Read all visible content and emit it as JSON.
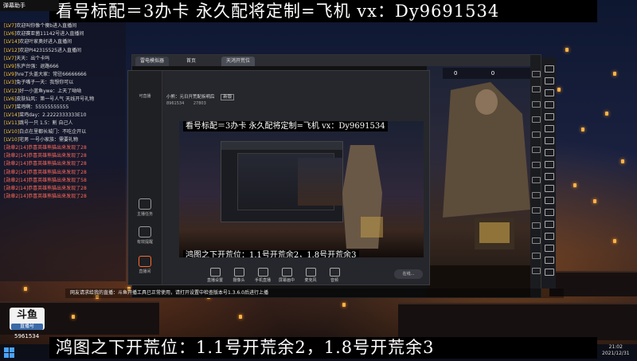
{
  "banner": {
    "top": "看号标配＝3办卡 永久配将定制=飞机 vx：Dy9691534",
    "bottom": "鸿图之下开荒位：1.1号开荒余2，1.8号开荒余3"
  },
  "nested_banner": {
    "top": "看号标配＝3办卡 永久配将定制=飞机 vx：Dy9691534",
    "bottom": "鸿图之下开荒位：1.1号开荒余2，1.8号开荒余3"
  },
  "chat": {
    "top_tag": "弹幕助手",
    "lines": [
      {
        "prefix": "[LV7]",
        "text": "欢迎叫你像个傻b进入直播间"
      },
      {
        "prefix": "[LV6]",
        "text": "欢迎赛亚菌11142号进入直播间"
      },
      {
        "prefix": "[LV14]",
        "text": "欢迎叶家奥好进入直播间"
      },
      {
        "prefix": "[LV12]",
        "text": "欢迎PI42315525进入直播间"
      },
      {
        "prefix": "[LV7]",
        "text": "天天：出个卡吗"
      },
      {
        "prefix": "[LV9]",
        "text": "东庐台强：退路666"
      },
      {
        "prefix": "[LV9]",
        "text": "hre丁头盖大家：常驻66666666"
      },
      {
        "prefix": "[LV3]",
        "text": "兔子嘴子一天：我想你可以"
      },
      {
        "prefix": "[LV12]",
        "text": "好一小蓝鱼ywe：上天了呦呦"
      },
      {
        "prefix": "[LV6]",
        "text": "皮肤仙风：第一号人气 天线开号礼物"
      },
      {
        "prefix": "[LV7]",
        "text": "菜鸡啊：55555555555"
      },
      {
        "prefix": "[LV14]",
        "text": "菜鸡day：2.2222333333E10"
      },
      {
        "prefix": "[LV11]",
        "text": "跳号一只 1.5：割 自己人"
      },
      {
        "prefix": "[LV10]",
        "text": "白点在里都长城门：不吃企开以"
      },
      {
        "prefix": "[LV10]",
        "text": "宅男 一号小家族：需要礼物"
      },
      {
        "prefix": "[勋章2|14]",
        "text": "恭喜英雄熊猫出来发现了28",
        "red": true
      },
      {
        "prefix": "[勋章2|14]",
        "text": "恭喜英雄熊猫出来发现了28",
        "red": true
      },
      {
        "prefix": "[勋章2|14]",
        "text": "恭喜英雄熊猫出来发现了28",
        "red": true
      },
      {
        "prefix": "[勋章2|14]",
        "text": "恭喜英雄熊猫出来发现了28",
        "red": true
      },
      {
        "prefix": "[勋章2|14]",
        "text": "恭喜英雄熊猫出来发现了58",
        "red": true
      },
      {
        "prefix": "[勋章2|14]",
        "text": "恭喜英雄熊猫出来发现了28",
        "red": true
      },
      {
        "prefix": "[勋章2|14]",
        "text": "恭喜英雄熊猫出来发现了28",
        "red": true
      }
    ]
  },
  "emulator": {
    "tabs": [
      "雷电模拟器",
      "首页",
      "天鸿开荒位"
    ],
    "score_left": "0",
    "score_right": "0"
  },
  "app": {
    "nav": [
      "可直播",
      "",
      "",
      "",
      "",
      "主播任务",
      "有效提醒",
      "直播间"
    ],
    "title": "小熊：元日开荒配拆明后",
    "subtitle_tag": "新版",
    "stat_room": "8961534",
    "stat_fans": "27803",
    "toolbar": [
      "直播设置",
      "摄像头",
      "手机直播",
      "屏幕画中",
      "麦克风",
      "音频",
      "在线..."
    ]
  },
  "dock": {
    "text": "网友请求给我的直播：斗鱼开播工具已正常使用，请打开设置中检查版本号1.3.6.0后进行上播"
  },
  "douyu": {
    "logo": "斗鱼",
    "sub": "直播号",
    "room": "5961534"
  },
  "clock": {
    "time": "21:02",
    "date": "2021/12/31"
  }
}
